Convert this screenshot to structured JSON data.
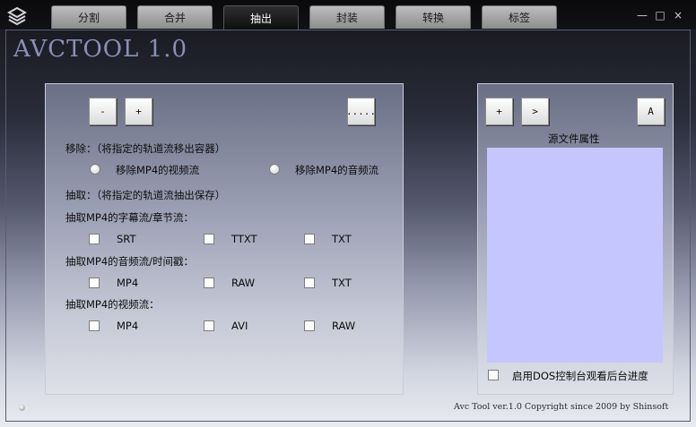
{
  "window": {
    "controls": {
      "minimize": "—",
      "maximize": "□",
      "close": "×"
    }
  },
  "tabs": [
    {
      "label": "分割",
      "active": false
    },
    {
      "label": "合并",
      "active": false
    },
    {
      "label": "抽出",
      "active": true
    },
    {
      "label": "封装",
      "active": false
    },
    {
      "label": "转换",
      "active": false
    },
    {
      "label": "标签",
      "active": false
    }
  ],
  "app_title": "AVCTOOL 1.0",
  "left_panel": {
    "buttons": {
      "minus": "-",
      "plus": "+",
      "browse": "....."
    },
    "remove_label": "移除：（将指定的轨道流移出容器）",
    "remove_video": "移除MP4的视频流",
    "remove_audio": "移除MP4的音频流",
    "extract_label": "抽取：（将指定的轨道流抽出保存）",
    "subtitle_label": "抽取MP4的字幕流/章节流：",
    "subtitle_options": [
      "SRT",
      "TTXT",
      "TXT"
    ],
    "audio_label": "抽取MP4的音频流/时间戳：",
    "audio_options": [
      "MP4",
      "RAW",
      "TXT"
    ],
    "video_label": "抽取MP4的视频流：",
    "video_options": [
      "MP4",
      "AVI",
      "RAW"
    ]
  },
  "right_panel": {
    "buttons": {
      "add": "+",
      "next": ">",
      "a": "A"
    },
    "props_label": "源文件属性",
    "dos_label": "启用DOS控制台观看后台进度"
  },
  "footer": "Avc Tool ver.1.0 Copyright since 2009 by Shinsoft",
  "colors": {
    "list_bg": "#c6c6fe",
    "active_tab": "#111111",
    "title": "#8a90b8"
  }
}
